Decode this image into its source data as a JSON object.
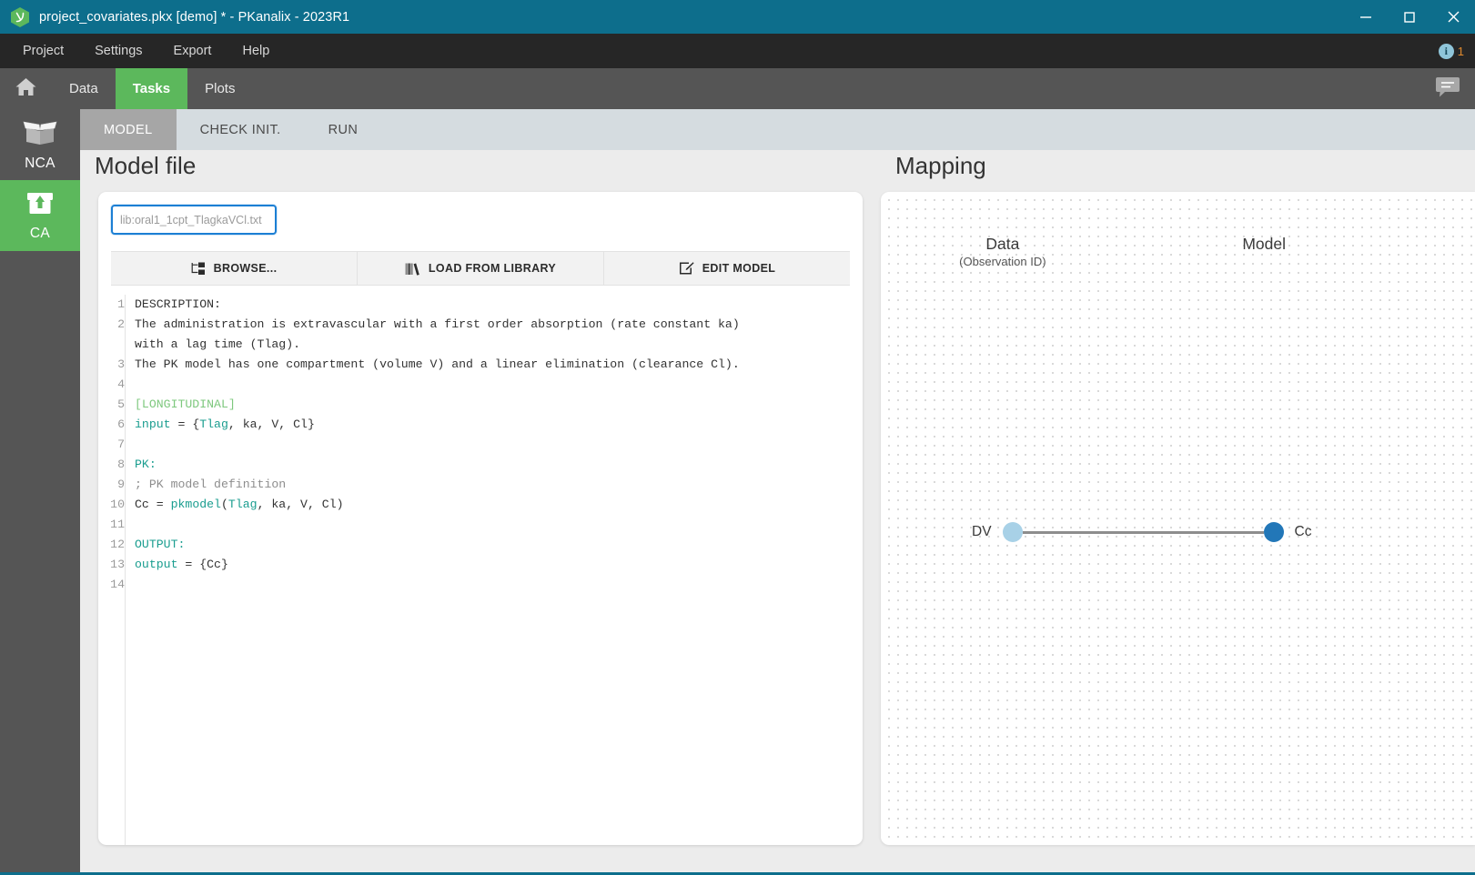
{
  "window": {
    "title": "project_covariates.pkx [demo] * - PKanalix - 2023R1",
    "logo_icon": "pkanalix-hexagon-logo",
    "minimize_icon": "minimize-icon",
    "maximize_icon": "maximize-icon",
    "close_icon": "close-icon",
    "titlebar_color": "#0d6e8c"
  },
  "menubar": {
    "items": [
      {
        "label": "Project"
      },
      {
        "label": "Settings"
      },
      {
        "label": "Export"
      },
      {
        "label": "Help"
      }
    ],
    "info_icon": "info-icon",
    "info_glyph": "i",
    "info_count": "1",
    "info_count_color": "#e08a2e"
  },
  "navbar": {
    "home_icon": "home-icon",
    "tabs": [
      {
        "label": "Data",
        "active": false
      },
      {
        "label": "Tasks",
        "active": true
      },
      {
        "label": "Plots",
        "active": false
      }
    ],
    "active_color": "#5cb85c",
    "chat_icon": "chat-bubble-icon"
  },
  "sidebar": {
    "items": [
      {
        "label": "NCA",
        "icon": "open-box-icon",
        "active": false
      },
      {
        "label": "CA",
        "icon": "closed-box-upload-icon",
        "active": true
      }
    ]
  },
  "subtabs": {
    "items": [
      {
        "label": "MODEL",
        "active": true
      },
      {
        "label": "CHECK INIT.",
        "active": false
      },
      {
        "label": "RUN",
        "active": false
      }
    ]
  },
  "model_panel": {
    "title": "Model file",
    "file_input": {
      "value": "",
      "placeholder": "lib:oral1_1cpt_TlagkaVCl.txt",
      "focus_color": "#1c7fd4"
    },
    "buttons": [
      {
        "label": "BROWSE...",
        "icon": "file-browse-icon"
      },
      {
        "label": "LOAD FROM LIBRARY",
        "icon": "books-library-icon"
      },
      {
        "label": "EDIT MODEL",
        "icon": "pencil-edit-icon"
      }
    ],
    "editor": {
      "line_numbers": [
        "1",
        "2",
        "",
        "3",
        "4",
        "5",
        "6",
        "7",
        "8",
        "9",
        "10",
        "11",
        "12",
        "13",
        "14"
      ],
      "lines": [
        {
          "n": "1",
          "segments": [
            {
              "t": "DESCRIPTION:",
              "c": "plain"
            }
          ]
        },
        {
          "n": "2",
          "segments": [
            {
              "t": "The administration is extravascular with a first order absorption (rate constant ka)",
              "c": "plain"
            }
          ]
        },
        {
          "n": "",
          "segments": [
            {
              "t": "with a lag time (Tlag).",
              "c": "plain"
            }
          ]
        },
        {
          "n": "3",
          "segments": [
            {
              "t": "The PK model has one compartment (volume V) and a linear elimination (clearance Cl).",
              "c": "plain"
            }
          ]
        },
        {
          "n": "4",
          "segments": [
            {
              "t": "",
              "c": "plain"
            }
          ]
        },
        {
          "n": "5",
          "segments": [
            {
              "t": "[LONGITUDINAL]",
              "c": "section"
            }
          ]
        },
        {
          "n": "6",
          "segments": [
            {
              "t": "input",
              "c": "kw"
            },
            {
              "t": " = {",
              "c": "plain"
            },
            {
              "t": "Tlag",
              "c": "var"
            },
            {
              "t": ", ka, V, Cl}",
              "c": "plain"
            }
          ]
        },
        {
          "n": "7",
          "segments": [
            {
              "t": "",
              "c": "plain"
            }
          ]
        },
        {
          "n": "8",
          "segments": [
            {
              "t": "PK:",
              "c": "pk"
            }
          ]
        },
        {
          "n": "9",
          "segments": [
            {
              "t": "; PK model definition",
              "c": "cmt"
            }
          ]
        },
        {
          "n": "10",
          "segments": [
            {
              "t": "Cc = ",
              "c": "plain"
            },
            {
              "t": "pkmodel",
              "c": "fn"
            },
            {
              "t": "(",
              "c": "plain"
            },
            {
              "t": "Tlag",
              "c": "var"
            },
            {
              "t": ", ka, V, Cl)",
              "c": "plain"
            }
          ]
        },
        {
          "n": "11",
          "segments": [
            {
              "t": "",
              "c": "plain"
            }
          ]
        },
        {
          "n": "12",
          "segments": [
            {
              "t": "OUTPUT:",
              "c": "pk"
            }
          ]
        },
        {
          "n": "13",
          "segments": [
            {
              "t": "output",
              "c": "kw"
            },
            {
              "t": " = {Cc}",
              "c": "plain"
            }
          ]
        },
        {
          "n": "14",
          "segments": [
            {
              "t": "",
              "c": "plain"
            }
          ]
        }
      ]
    }
  },
  "mapping_panel": {
    "title": "Mapping",
    "col_data_label": "Data",
    "col_data_sub": "(Observation ID)",
    "col_model_label": "Model",
    "links": [
      {
        "source_label": "DV",
        "target_label": "Cc",
        "source_color": "#a8d1e7",
        "target_color": "#2277b8"
      }
    ]
  }
}
